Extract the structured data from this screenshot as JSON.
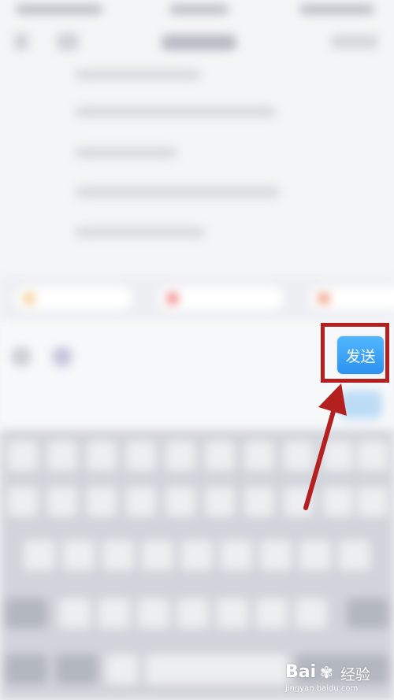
{
  "send_button": {
    "label": "发送"
  },
  "colors": {
    "highlight_frame": "#b41f1f",
    "send_button": "#3aa5f7",
    "arrow": "#b41f1f"
  },
  "watermark": {
    "logo": "Bai",
    "logo_icon": "paw-icon",
    "site": "经验",
    "url": "jingyan.baidu.com"
  }
}
